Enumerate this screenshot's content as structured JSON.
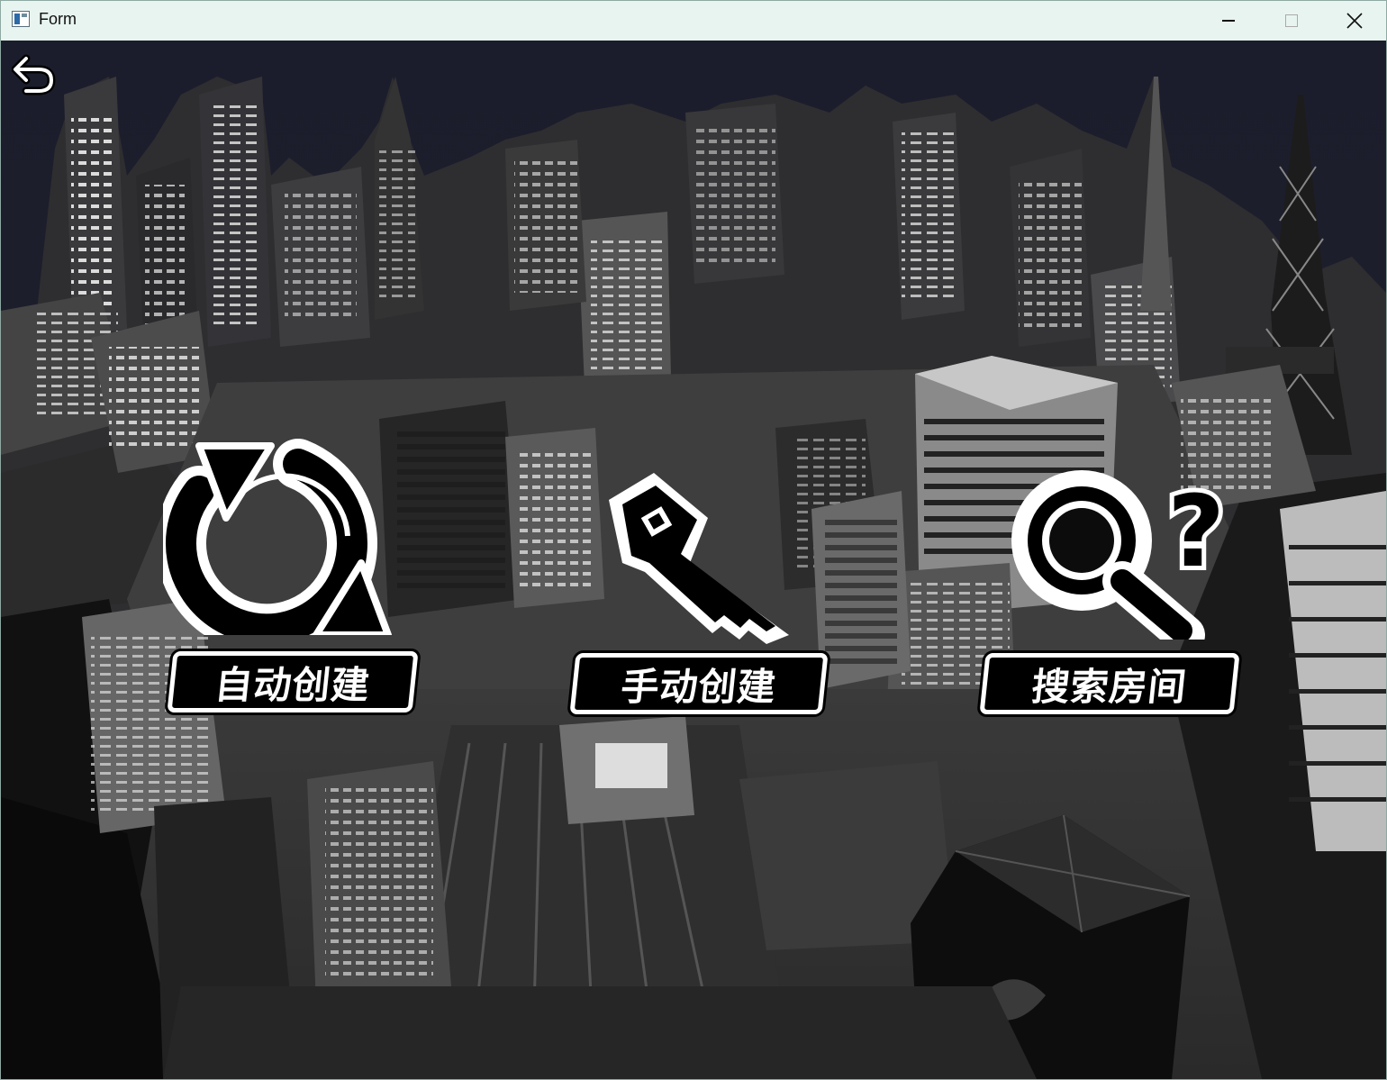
{
  "window": {
    "title": "Form"
  },
  "icons": {
    "app": "app-window-icon",
    "minimize": "minimize-icon",
    "maximize": "maximize-icon",
    "close": "close-icon",
    "back": "back-arrow-icon",
    "auto_create": "refresh-cycle-icon",
    "manual_create": "key-icon",
    "search_room": "magnifier-question-icon"
  },
  "menu": {
    "auto_create_label": "自动创建",
    "manual_create_label": "手动创建",
    "search_room_label": "搜索房间"
  },
  "colors": {
    "sky": "#1a1b26",
    "building_dark": "#1f1f1f",
    "building_mid": "#4a4a4a",
    "building_light": "#8a8a8a",
    "window_light": "#f2f2f2",
    "titlebar": "#e8f4ef"
  }
}
